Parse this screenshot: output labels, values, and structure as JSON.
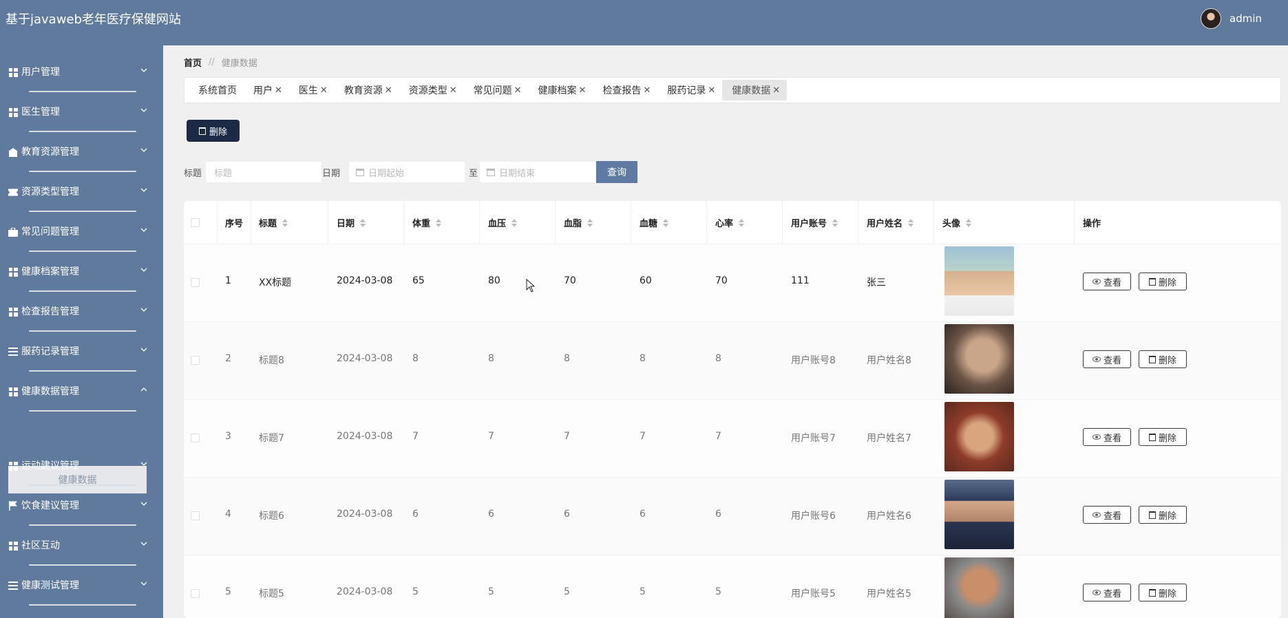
{
  "app": {
    "title": "基于javaweb老年医疗保健网站",
    "user": "admin"
  },
  "sidebar": {
    "items": [
      {
        "label": "用户管理",
        "icon": "grid-icon"
      },
      {
        "label": "医生管理",
        "icon": "grid-icon"
      },
      {
        "label": "教育资源管理",
        "icon": "building-icon"
      },
      {
        "label": "资源类型管理",
        "icon": "ticket-icon"
      },
      {
        "label": "常见问题管理",
        "icon": "briefcase-icon"
      },
      {
        "label": "健康档案管理",
        "icon": "grid-icon"
      },
      {
        "label": "检查报告管理",
        "icon": "grid-icon"
      },
      {
        "label": "服药记录管理",
        "icon": "bars-icon"
      },
      {
        "label": "健康数据管理",
        "icon": "grid-icon",
        "expanded": true
      },
      {
        "label": "运动建议管理",
        "icon": "grid-icon"
      },
      {
        "label": "饮食建议管理",
        "icon": "flag-icon"
      },
      {
        "label": "社区互动",
        "icon": "grid-icon"
      },
      {
        "label": "健康测试管理",
        "icon": "bars-icon"
      }
    ],
    "active_sub": "健康数据"
  },
  "breadcrumb": {
    "home": "首页",
    "sep": "//",
    "current": "健康数据"
  },
  "tabs": [
    {
      "label": "系统首页",
      "closable": false
    },
    {
      "label": "用户",
      "closable": true
    },
    {
      "label": "医生",
      "closable": true
    },
    {
      "label": "教育资源",
      "closable": true
    },
    {
      "label": "资源类型",
      "closable": true
    },
    {
      "label": "常见问题",
      "closable": true
    },
    {
      "label": "健康档案",
      "closable": true
    },
    {
      "label": "检查报告",
      "closable": true
    },
    {
      "label": "服药记录",
      "closable": true
    },
    {
      "label": "健康数据",
      "closable": true,
      "active": true
    }
  ],
  "toolbar": {
    "delete_label": "删除"
  },
  "search": {
    "title_label": "标题",
    "title_placeholder": "标题",
    "date_label": "日期",
    "date_start_placeholder": "日期起始",
    "to_label": "至",
    "date_end_placeholder": "日期结束",
    "query_label": "查询"
  },
  "table": {
    "headers": [
      "序号",
      "标题",
      "日期",
      "体重",
      "血压",
      "血脂",
      "血糖",
      "心率",
      "用户账号",
      "用户姓名",
      "头像",
      "操作"
    ],
    "view_label": "查看",
    "delete_label": "删除",
    "rows": [
      {
        "index": "1",
        "title": "XX标题",
        "date": "2024-03-08",
        "weight": "65",
        "bp": "80",
        "lipid": "70",
        "sugar": "60",
        "hr": "70",
        "account": "111",
        "name": "张三"
      },
      {
        "index": "2",
        "title": "标题8",
        "date": "2024-03-08",
        "weight": "8",
        "bp": "8",
        "lipid": "8",
        "sugar": "8",
        "hr": "8",
        "account": "用户账号8",
        "name": "用户姓名8"
      },
      {
        "index": "3",
        "title": "标题7",
        "date": "2024-03-08",
        "weight": "7",
        "bp": "7",
        "lipid": "7",
        "sugar": "7",
        "hr": "7",
        "account": "用户账号7",
        "name": "用户姓名7"
      },
      {
        "index": "4",
        "title": "标题6",
        "date": "2024-03-08",
        "weight": "6",
        "bp": "6",
        "lipid": "6",
        "sugar": "6",
        "hr": "6",
        "account": "用户账号6",
        "name": "用户姓名6"
      },
      {
        "index": "5",
        "title": "标题5",
        "date": "2024-03-08",
        "weight": "5",
        "bp": "5",
        "lipid": "5",
        "sugar": "5",
        "hr": "5",
        "account": "用户账号5",
        "name": "用户姓名5"
      }
    ]
  },
  "colors": {
    "header": "#607a9e",
    "sidebar": "#607a9e",
    "delete_button": "#1c2a46",
    "query_button": "#5f7ba3"
  }
}
